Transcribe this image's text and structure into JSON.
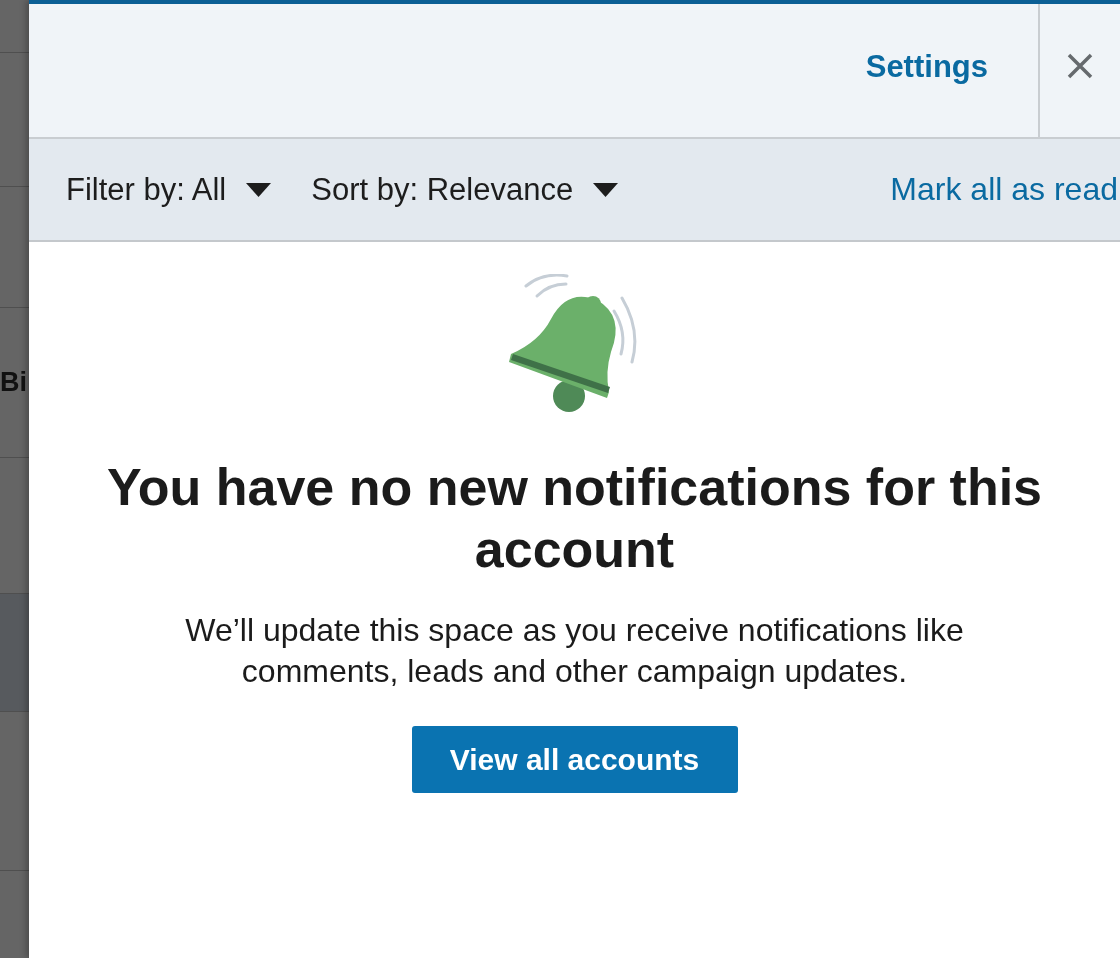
{
  "backdrop": {
    "text": "Bi"
  },
  "header": {
    "settings_link": "Settings"
  },
  "toolbar": {
    "filters": [
      {
        "label": "Filter by: All"
      },
      {
        "label": "Sort by: Relevance"
      }
    ],
    "mark_all_read": "Mark all as read"
  },
  "empty_state": {
    "title": "You have no new notifications for this account",
    "message": "We’ll update this space as you receive notifications like comments, leads and other campaign updates.",
    "button": "View all accounts"
  }
}
